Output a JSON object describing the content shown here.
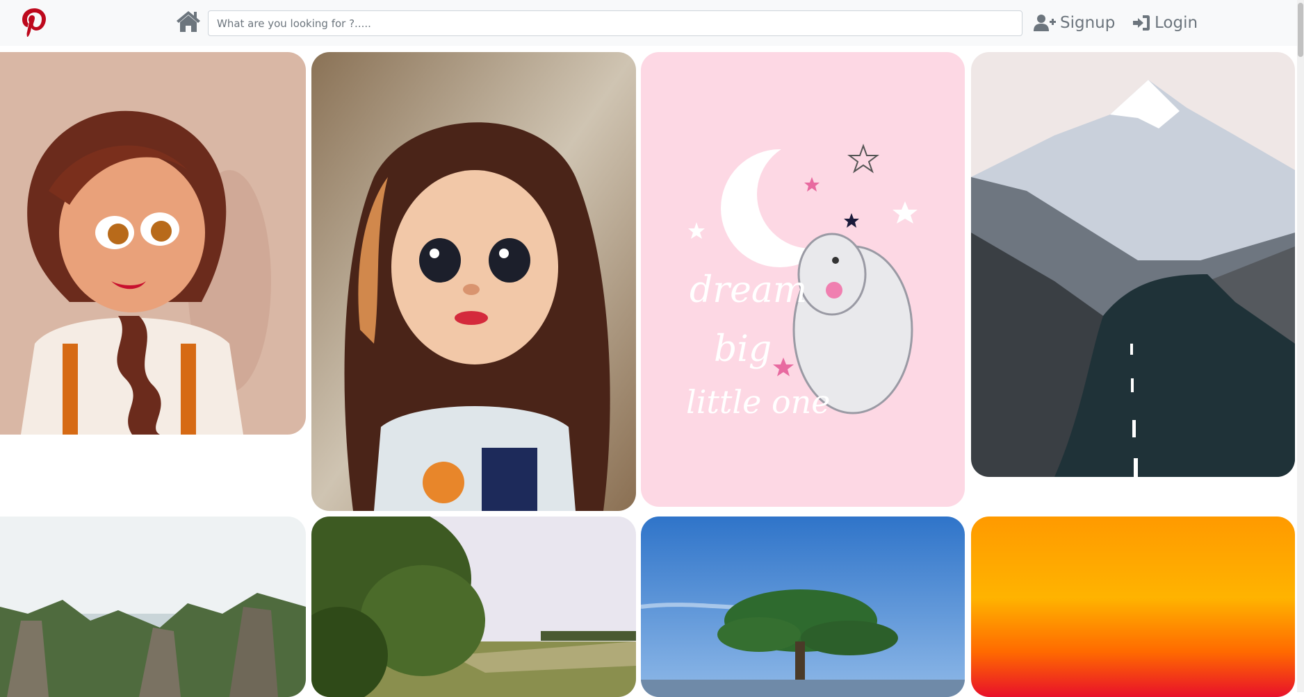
{
  "navbar": {
    "logo_icon": "pinterest-logo-icon",
    "home_icon": "home-icon",
    "search_placeholder": "What are you looking for ?.....",
    "signup_label": "Signup",
    "signup_icon": "user-plus-icon",
    "login_label": "Login",
    "login_icon": "sign-in-icon",
    "brand_color": "#bd081c",
    "link_color": "#6c757d"
  },
  "pins": [
    {
      "subject": "cartoon girl with braid"
    },
    {
      "subject": "cartoon girl with long hair"
    },
    {
      "subject": "pink elephant illustration",
      "caption_lines": [
        "dream",
        "big",
        "little one"
      ]
    },
    {
      "subject": "snowy mountain road"
    },
    {
      "subject": "green cliffs by the sea"
    },
    {
      "subject": "trees and meadow"
    },
    {
      "subject": "lone pine tree under blue sky"
    },
    {
      "subject": "orange sunset gradient"
    }
  ]
}
